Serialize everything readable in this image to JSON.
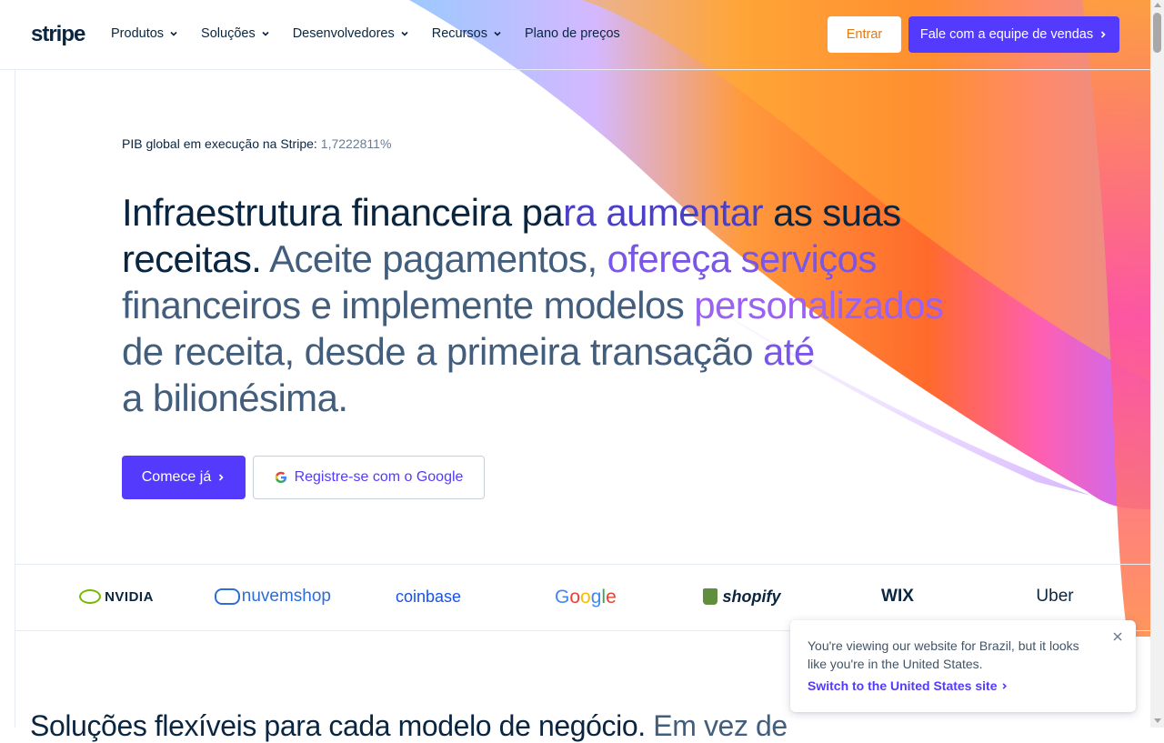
{
  "header": {
    "logo": "stripe",
    "nav": [
      {
        "label": "Produtos",
        "dropdown": true
      },
      {
        "label": "Soluções",
        "dropdown": true
      },
      {
        "label": "Desenvolvedores",
        "dropdown": true
      },
      {
        "label": "Recursos",
        "dropdown": true
      },
      {
        "label": "Plano de preços",
        "dropdown": false
      }
    ],
    "signin_label": "Entrar",
    "contact_sales_label": "Fale com a equipe de vendas"
  },
  "hero": {
    "gdp_label": "PIB global em execução na Stripe:",
    "gdp_value": "1,7222811",
    "gdp_unit": "%",
    "headline": {
      "line1_a": "Infraestrutura financeira pa",
      "line1_b": "ra aumentar ",
      "line1_c": "as suas",
      "line2_a": "receitas. ",
      "line2_b": "Aceite pagamentos, ",
      "line2_c": "ofereça serviços",
      "line3_a": "financeiros e implemente modelos ",
      "line3_b": "personalizados",
      "line4_a": "de receita, desde a primeira transação ",
      "line4_b": "até",
      "line5": "a bilionésima."
    },
    "cta_primary": "Comece já",
    "cta_google": "Registre-se com o Google"
  },
  "logos": [
    "NVIDIA",
    "nuvemshop",
    "coinbase",
    "Google",
    "shopify",
    "WIX",
    "Uber"
  ],
  "bottom_heading": {
    "dark": "Soluções flexíveis para cada modelo de negócio.",
    "soft": "Em vez de"
  },
  "locale_popup": {
    "message": "You're viewing our website for Brazil, but it looks like you're in the United States.",
    "link_label": "Switch to the United States site"
  },
  "colors": {
    "brand_purple": "#533afd",
    "navy": "#0a2540",
    "slate": "#425e7c",
    "orange_text": "#e07a16"
  }
}
